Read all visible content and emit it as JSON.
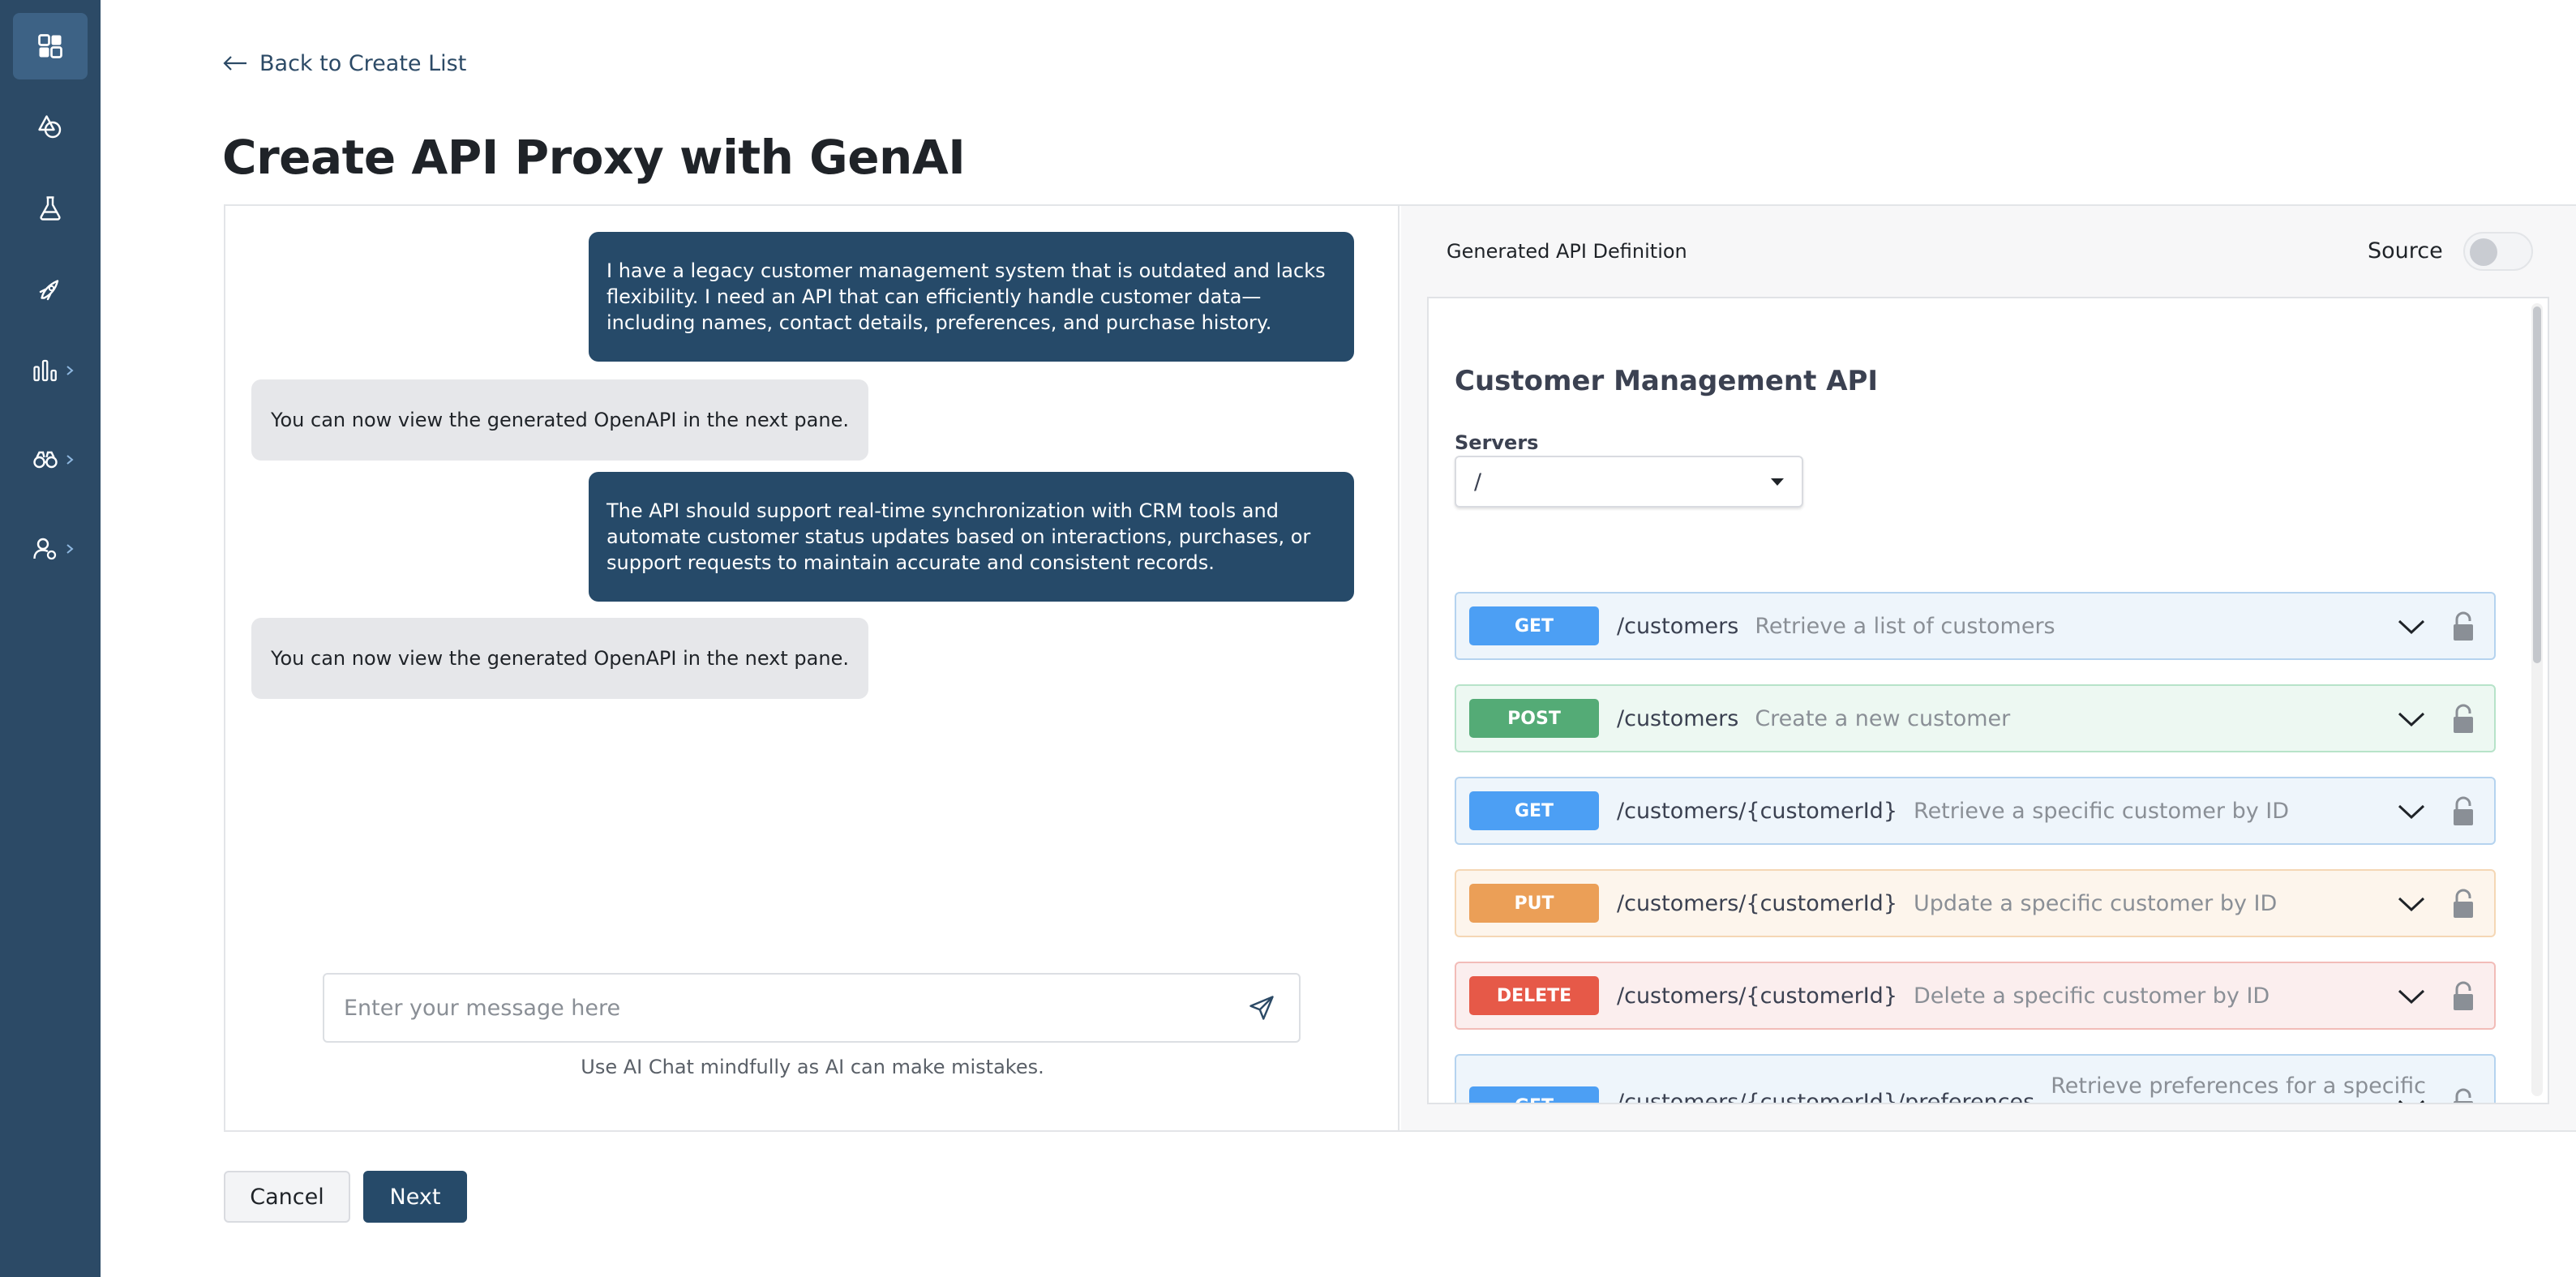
{
  "nav": {
    "back_label": "Back to Create List",
    "page_title": "Create API Proxy with GenAI"
  },
  "sidebar": {
    "items": [
      {
        "icon": "dashboard-icon",
        "active": true
      },
      {
        "icon": "shapes-icon"
      },
      {
        "icon": "flask-icon"
      },
      {
        "icon": "rocket-icon"
      },
      {
        "icon": "analytics-icon",
        "has_submenu": true
      },
      {
        "icon": "binoculars-icon",
        "has_submenu": true
      },
      {
        "icon": "user-settings-icon",
        "has_submenu": true
      }
    ]
  },
  "chat": {
    "messages": [
      {
        "role": "user",
        "text": "I have a legacy customer management system that is outdated and lacks flexibility. I need an API that can efficiently handle customer data—including names, contact details, preferences, and purchase history."
      },
      {
        "role": "assistant",
        "text": "You can now view the generated OpenAPI in the next pane."
      },
      {
        "role": "user",
        "text": "The API should support real-time synchronization with CRM tools and automate customer status updates based on interactions, purchases, or support requests to maintain accurate and consistent records."
      },
      {
        "role": "assistant",
        "text": "You can now view the generated OpenAPI in the next pane."
      }
    ],
    "input_placeholder": "Enter your message here",
    "input_value": "",
    "disclaimer": "Use AI Chat mindfully as AI can make mistakes."
  },
  "definition": {
    "pane_title": "Generated API Definition",
    "source_label": "Source",
    "source_enabled": false,
    "api_title": "Customer Management API",
    "servers_label": "Servers",
    "server_selected": "/",
    "operations": [
      {
        "method": "GET",
        "path": "/customers",
        "summary": "Retrieve a list of customers"
      },
      {
        "method": "POST",
        "path": "/customers",
        "summary": "Create a new customer"
      },
      {
        "method": "GET",
        "path": "/customers/{customerId}",
        "summary": "Retrieve a specific customer by ID"
      },
      {
        "method": "PUT",
        "path": "/customers/{customerId}",
        "summary": "Update a specific customer by ID"
      },
      {
        "method": "DELETE",
        "path": "/customers/{customerId}",
        "summary": "Delete a specific customer by ID"
      },
      {
        "method": "GET",
        "path": "/customers/{customerId}/preferences",
        "summary": "Retrieve preferences for a specific"
      }
    ]
  },
  "footer": {
    "cancel_label": "Cancel",
    "next_label": "Next"
  },
  "colors": {
    "sidebar": "#2c4a66",
    "primary": "#264a69",
    "get": "#4c9ff4",
    "post": "#54ab76",
    "put": "#eb9f57",
    "delete": "#e65948"
  }
}
